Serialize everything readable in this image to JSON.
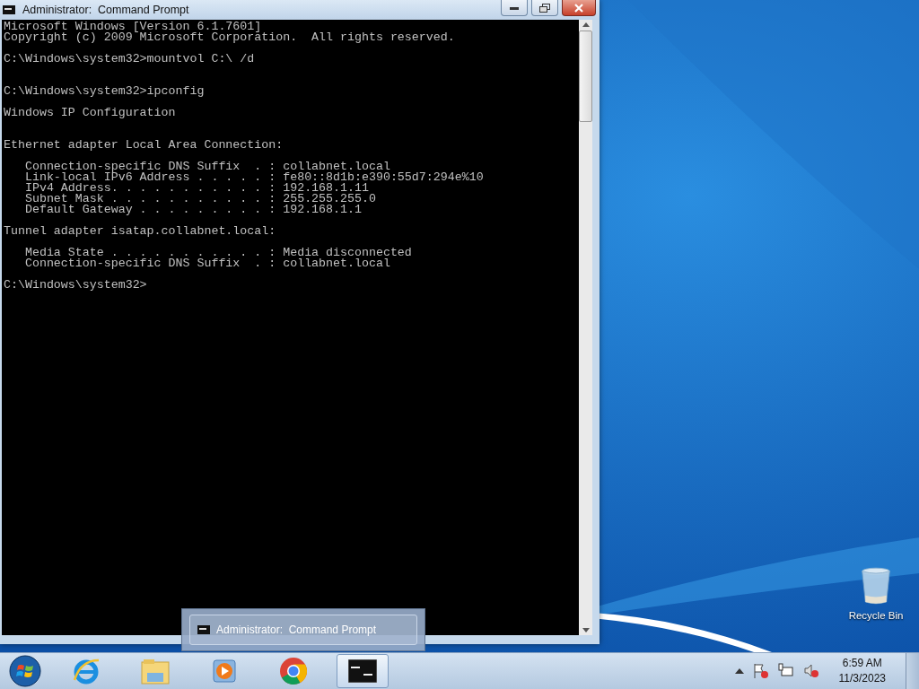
{
  "window": {
    "title": "Administrator:  Command Prompt",
    "console_text": "Microsoft Windows [Version 6.1.7601]\nCopyright (c) 2009 Microsoft Corporation.  All rights reserved.\n\nC:\\Windows\\system32>mountvol C:\\ /d\n\n\nC:\\Windows\\system32>ipconfig\n\nWindows IP Configuration\n\n\nEthernet adapter Local Area Connection:\n\n   Connection-specific DNS Suffix  . : collabnet.local\n   Link-local IPv6 Address . . . . . : fe80::8d1b:e390:55d7:294e%10\n   IPv4 Address. . . . . . . . . . . : 192.168.1.11\n   Subnet Mask . . . . . . . . . . . : 255.255.255.0\n   Default Gateway . . . . . . . . . : 192.168.1.1\n\nTunnel adapter isatap.collabnet.local:\n\n   Media State . . . . . . . . . . . : Media disconnected\n   Connection-specific DNS Suffix  . : collabnet.local\n\nC:\\Windows\\system32>"
  },
  "desktop": {
    "icons": [
      {
        "label": "Recycle Bin"
      }
    ]
  },
  "taskbar": {
    "preview": {
      "title": "Administrator:  Command Prompt"
    },
    "apps": [
      {
        "kind": "start",
        "active": false
      },
      {
        "kind": "ie",
        "active": false
      },
      {
        "kind": "explorer",
        "active": false
      },
      {
        "kind": "media",
        "active": false
      },
      {
        "kind": "chrome",
        "active": false
      },
      {
        "kind": "cmd",
        "active": true
      }
    ],
    "tray": {
      "time": "6:59 AM",
      "date": "11/3/2023"
    }
  }
}
